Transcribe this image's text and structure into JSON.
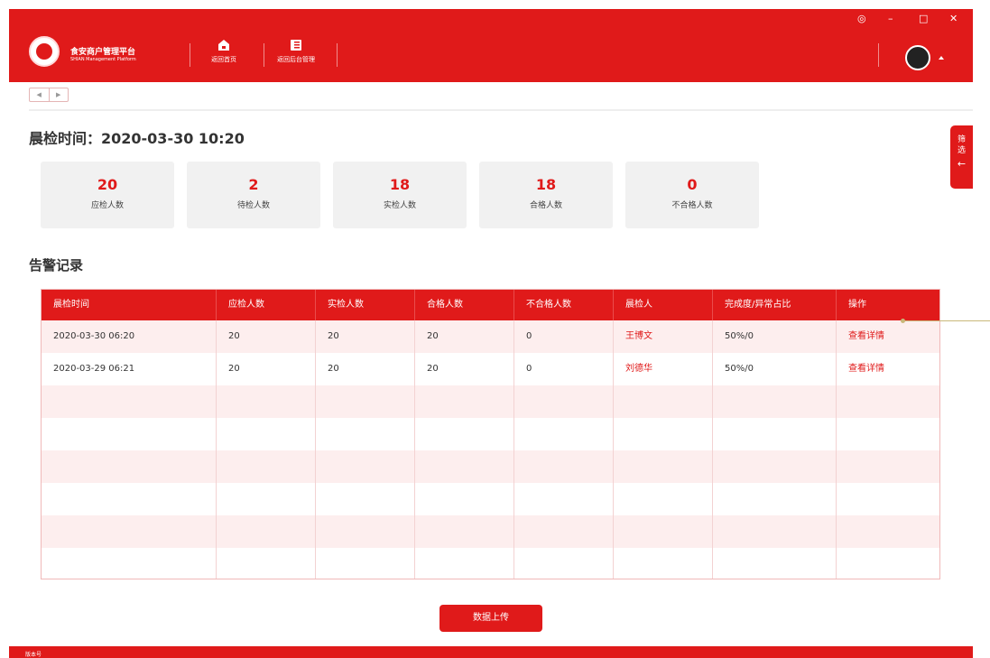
{
  "header": {
    "brand_cn": "食安商户管理平台",
    "brand_en": "SHIAN Management Platform",
    "nav": [
      {
        "label": "返回首页",
        "icon": "home-icon"
      },
      {
        "label": "返回后台管理",
        "icon": "panel-icon"
      }
    ],
    "window_controls": {
      "settings": "◎",
      "minimize": "–",
      "maximize": "□",
      "close": "✕"
    }
  },
  "tabnav": {
    "prev": "◀",
    "next": "▶"
  },
  "inspection": {
    "title": "晨检时间：2020-03-30 10:20",
    "stats": [
      {
        "value": "20",
        "label": "应检人数"
      },
      {
        "value": "2",
        "label": "待检人数"
      },
      {
        "value": "18",
        "label": "实检人数"
      },
      {
        "value": "18",
        "label": "合格人数"
      },
      {
        "value": "0",
        "label": "不合格人数"
      }
    ]
  },
  "filter": {
    "label": "筛选",
    "arrow": "←"
  },
  "alerts": {
    "title": "告警记录",
    "columns": [
      "晨检时间",
      "应检人数",
      "实检人数",
      "合格人数",
      "不合格人数",
      "晨检人",
      "完成度/异常占比",
      "操作"
    ],
    "rows": [
      [
        "2020-03-30 06:20",
        "20",
        "20",
        "20",
        "0",
        "王博文",
        "50%/0",
        "查看详情"
      ],
      [
        "2020-03-29 06:21",
        "20",
        "20",
        "20",
        "0",
        "刘德华",
        "50%/0",
        "查看详情"
      ]
    ]
  },
  "upload_button": "数据上传",
  "footer": {
    "text": "版本号"
  },
  "colors": {
    "brand_red": "#e01a1a",
    "card_bg": "#f1f1f1",
    "stripe": "#fdeeee"
  }
}
